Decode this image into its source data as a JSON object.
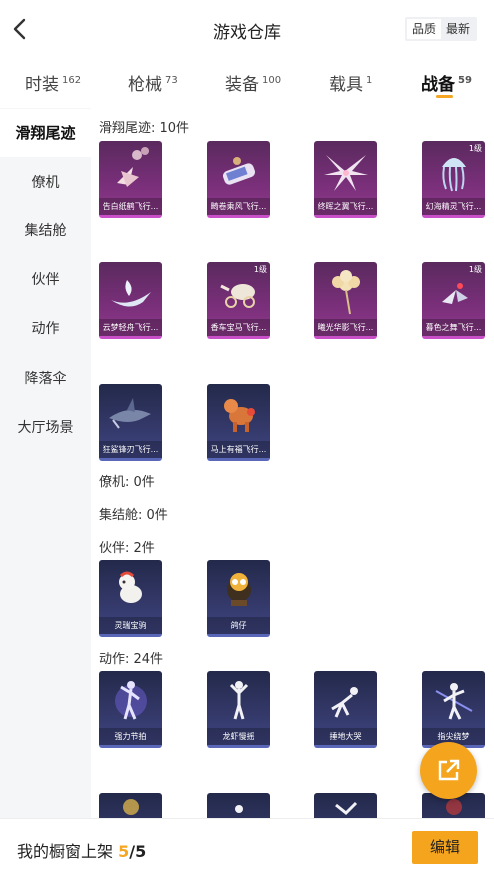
{
  "header": {
    "title": "游戏仓库",
    "sort_options": [
      "品质",
      "最新"
    ],
    "sort_selected": "品质"
  },
  "tabs": [
    {
      "label": "时装",
      "count": "162"
    },
    {
      "label": "枪械",
      "count": "73"
    },
    {
      "label": "装备",
      "count": "100"
    },
    {
      "label": "载具",
      "count": "1"
    },
    {
      "label": "战备",
      "count": "59"
    }
  ],
  "active_tab": "战备",
  "sidebar": {
    "items": [
      "滑翔尾迹",
      "僚机",
      "集结舱",
      "伙伴",
      "动作",
      "降落伞",
      "大厅场景"
    ],
    "active": "滑翔尾迹"
  },
  "sections": {
    "trail": {
      "label": "滑翔尾迹: 10件",
      "items": [
        {
          "name": "告白纸鹤飞行...",
          "level": ""
        },
        {
          "name": "畸卷乘风飞行...",
          "level": ""
        },
        {
          "name": "终晖之翼飞行...",
          "level": ""
        },
        {
          "name": "幻海精灵飞行...",
          "level": "1级"
        },
        {
          "name": "云梦轻舟飞行...",
          "level": ""
        },
        {
          "name": "香车宝马飞行...",
          "level": "1级"
        },
        {
          "name": "曦光华影飞行...",
          "level": ""
        },
        {
          "name": "暮色之舞飞行...",
          "level": "1级"
        },
        {
          "name": "狂鲨锋刃飞行...",
          "level": ""
        },
        {
          "name": "马上有福飞行...",
          "level": ""
        }
      ]
    },
    "wingman": {
      "label": "僚机: 0件"
    },
    "capsule": {
      "label": "集结舱: 0件"
    },
    "partner": {
      "label": "伙伴: 2件",
      "items": [
        {
          "name": "灵瑞宝驹"
        },
        {
          "name": "鸽仔"
        }
      ]
    },
    "emote": {
      "label": "动作: 24件",
      "items": [
        {
          "name": "强力节拍"
        },
        {
          "name": "龙虾慢摇"
        },
        {
          "name": "捶地大哭"
        },
        {
          "name": "指尖绕梦"
        }
      ]
    }
  },
  "bottom": {
    "text": "我的橱窗上架",
    "count": "5",
    "total": "/5",
    "edit_label": "编辑"
  },
  "colors": {
    "accent": "#f5a623",
    "legendary": "#8e3a8c",
    "epic": "#3f4682"
  }
}
